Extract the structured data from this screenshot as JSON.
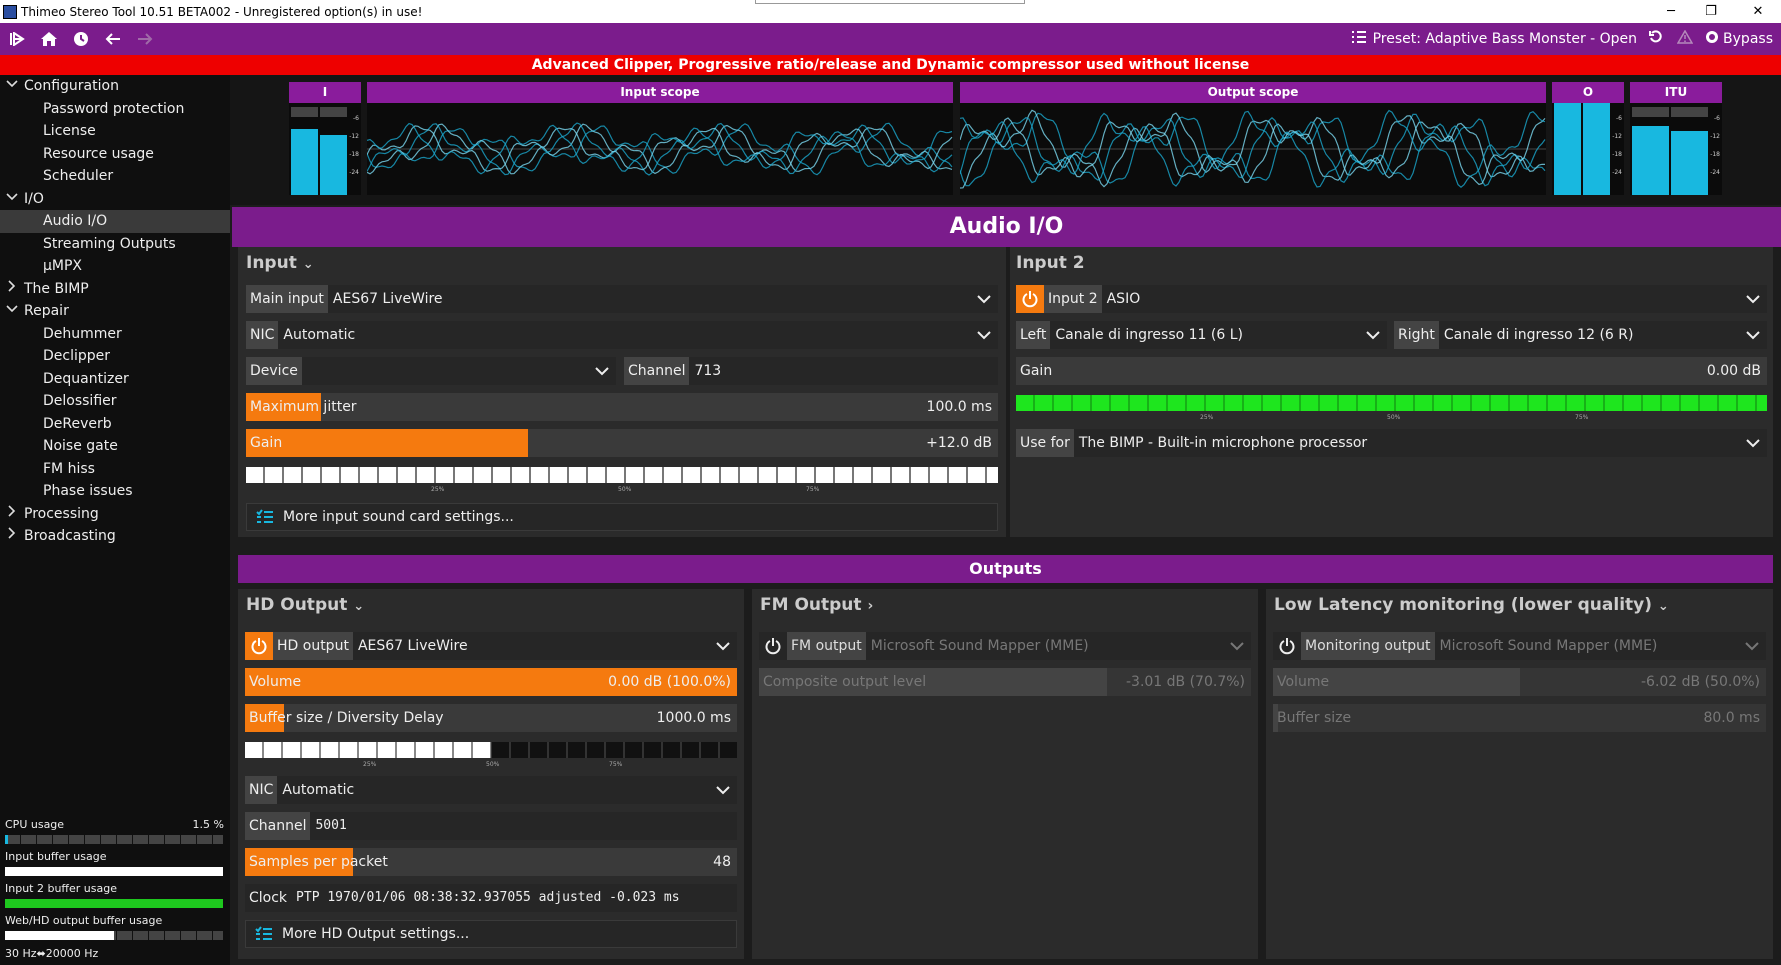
{
  "window": {
    "title": "Thimeo Stereo Tool 10.51 BETA002 - Unregistered option(s) in use!",
    "min_glyph": "─",
    "max_glyph": "❐",
    "close_glyph": "✕"
  },
  "toolbar": {
    "preset_label": "Preset: Adaptive Bass Monster - Open",
    "bypass_label": "Bypass"
  },
  "warning": "Advanced Clipper, Progressive ratio/release and Dynamic compressor used without license",
  "sidebar": {
    "items": [
      {
        "label": "Configuration",
        "level": 0,
        "chevron": "expanded"
      },
      {
        "label": "Password protection",
        "level": 1
      },
      {
        "label": "License",
        "level": 1
      },
      {
        "label": "Resource usage",
        "level": 1
      },
      {
        "label": "Scheduler",
        "level": 1
      },
      {
        "label": "I/O",
        "level": 0,
        "chevron": "expanded"
      },
      {
        "label": "Audio I/O",
        "level": 1,
        "selected": true
      },
      {
        "label": "Streaming Outputs",
        "level": 1
      },
      {
        "label": "µMPX",
        "level": 1
      },
      {
        "label": "The BIMP",
        "level": 0,
        "chevron": "collapsed"
      },
      {
        "label": "Repair",
        "level": 0,
        "chevron": "expanded"
      },
      {
        "label": "Dehummer",
        "level": 1
      },
      {
        "label": "Declipper",
        "level": 1
      },
      {
        "label": "Dequantizer",
        "level": 1
      },
      {
        "label": "Delossifier",
        "level": 1
      },
      {
        "label": "DeReverb",
        "level": 1
      },
      {
        "label": "Noise gate",
        "level": 1
      },
      {
        "label": "FM hiss",
        "level": 1
      },
      {
        "label": "Phase issues",
        "level": 1
      },
      {
        "label": "Processing",
        "level": 0,
        "chevron": "collapsed"
      },
      {
        "label": "Broadcasting",
        "level": 0,
        "chevron": "collapsed"
      }
    ],
    "meters": [
      {
        "label": "CPU usage",
        "value": "1.5 %",
        "fill_percent": 1.5,
        "color": "#18b8e0"
      },
      {
        "label": "Input buffer usage",
        "value": "",
        "fill_percent": 100,
        "color": "#ffffff"
      },
      {
        "label": "Input 2 buffer usage",
        "value": "",
        "fill_percent": 100,
        "color": "#1ec81e"
      },
      {
        "label": "Web/HD output buffer usage",
        "value": "",
        "fill_percent": 50,
        "color": "#ffffff"
      }
    ],
    "freq_low": "30 Hz",
    "freq_high": "20000 Hz"
  },
  "scopes": {
    "i_label": "I",
    "input_label": "Input scope",
    "output_label": "Output scope",
    "o_label": "O",
    "itu_label": "ITU",
    "ticks": [
      "-6",
      "-12",
      "-18",
      "-24"
    ]
  },
  "section_title": "Audio I/O",
  "input": {
    "header": "Input",
    "main_input_label": "Main input",
    "main_input_value": "AES67 LiveWire",
    "nic_label": "NIC",
    "nic_value": "Automatic",
    "device_label": "Device",
    "device_value": "",
    "channel_label": "Channel",
    "channel_value": "713",
    "jitter_label": "Maximum jitter",
    "jitter_value": "100.0 ms",
    "jitter_fill_percent": 10,
    "gain_label": "Gain",
    "gain_value": "+12.0 dB",
    "gain_fill_percent": 37.5,
    "scale_labels": [
      "25%",
      "50%",
      "75%"
    ],
    "more_label": "More input sound card settings..."
  },
  "input2": {
    "header": "Input 2",
    "input2_label": "Input 2",
    "input2_value": "ASIO",
    "left_label": "Left",
    "left_value": "Canale di ingresso 11 (6 L)",
    "right_label": "Right",
    "right_value": "Canale di ingresso 12 (6 R)",
    "gain_label": "Gain",
    "gain_value": "0.00 dB",
    "gain_fill_percent": 0,
    "use_for_label": "Use for",
    "use_for_value": "The BIMP - Built-in microphone processor",
    "meter_color": "#1ee61e"
  },
  "outputs_title": "Outputs",
  "hd_output": {
    "header": "HD Output",
    "hd_label": "HD output",
    "hd_value": "AES67 LiveWire",
    "volume_label": "Volume",
    "volume_value": "0.00 dB (100.0%)",
    "volume_fill_percent": 100,
    "buffer_label": "Buffer size / Diversity Delay",
    "buffer_value": "1000.0 ms",
    "buffer_fill_percent": 8,
    "buffer_meter_percent": 50,
    "nic_label": "NIC",
    "nic_value": "Automatic",
    "channel_label": "Channel",
    "channel_value": "5001",
    "samples_label": "Samples per packet",
    "samples_value": "48",
    "samples_fill_percent": 22,
    "clock_label": "Clock",
    "clock_value": "PTP 1970/01/06 08:38:32.937055 adjusted -0.023 ms",
    "more_label": "More HD Output settings..."
  },
  "fm_output": {
    "header": "FM Output",
    "fm_label": "FM output",
    "fm_value": "Microsoft Sound Mapper (MME)",
    "composite_label": "Composite output level",
    "composite_value": "-3.01 dB (70.7%)",
    "composite_fill_percent": 70.7
  },
  "ll_output": {
    "header": "Low Latency monitoring (lower quality)",
    "mon_label": "Monitoring output",
    "mon_value": "Microsoft Sound Mapper (MME)",
    "volume_label": "Volume",
    "volume_value": "-6.02 dB (50.0%)",
    "volume_fill_percent": 50,
    "buffer_label": "Buffer size",
    "buffer_value": "80.0 ms",
    "buffer_fill_percent": 1
  }
}
